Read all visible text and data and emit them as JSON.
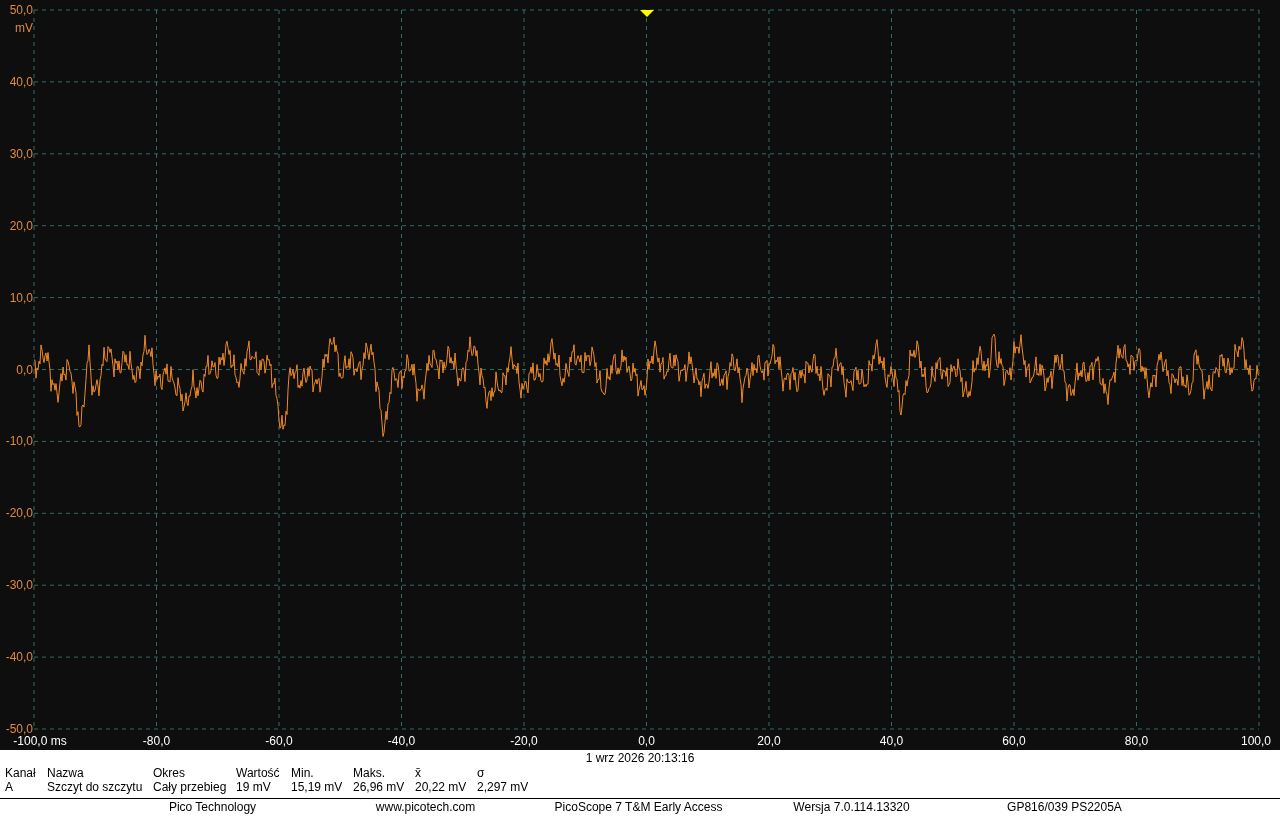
{
  "plot": {
    "y_unit": "mV",
    "y_ticks": [
      "50,0",
      "40,0",
      "30,0",
      "20,0",
      "10,0",
      "0,0",
      "-10,0",
      "-20,0",
      "-30,0",
      "-40,0",
      "-50,0"
    ],
    "x_ticks": [
      "-100,0 ms",
      "-80,0",
      "-60,0",
      "-40,0",
      "-20,0",
      "0,0",
      "20,0",
      "40,0",
      "60,0",
      "80,0",
      "100,0"
    ]
  },
  "timestamp": "1 wrz 2026 20:13:16",
  "measurements": {
    "columns": [
      "Kanał",
      "Nazwa",
      "Okres",
      "Wartość",
      "Min.",
      "Maks.",
      "x̄",
      "σ"
    ],
    "rows": [
      [
        "A",
        "Szczyt do szczytu",
        "Cały przebieg",
        "19 mV",
        "15,19 mV",
        "26,96 mV",
        "20,22 mV",
        "2,297 mV"
      ]
    ]
  },
  "footer": [
    "Pico Technology",
    "www.picotech.com",
    "PicoScope 7 T&M Early Access",
    "Wersja 7.0.114.13320",
    "GP816/039 PS2205A"
  ]
}
